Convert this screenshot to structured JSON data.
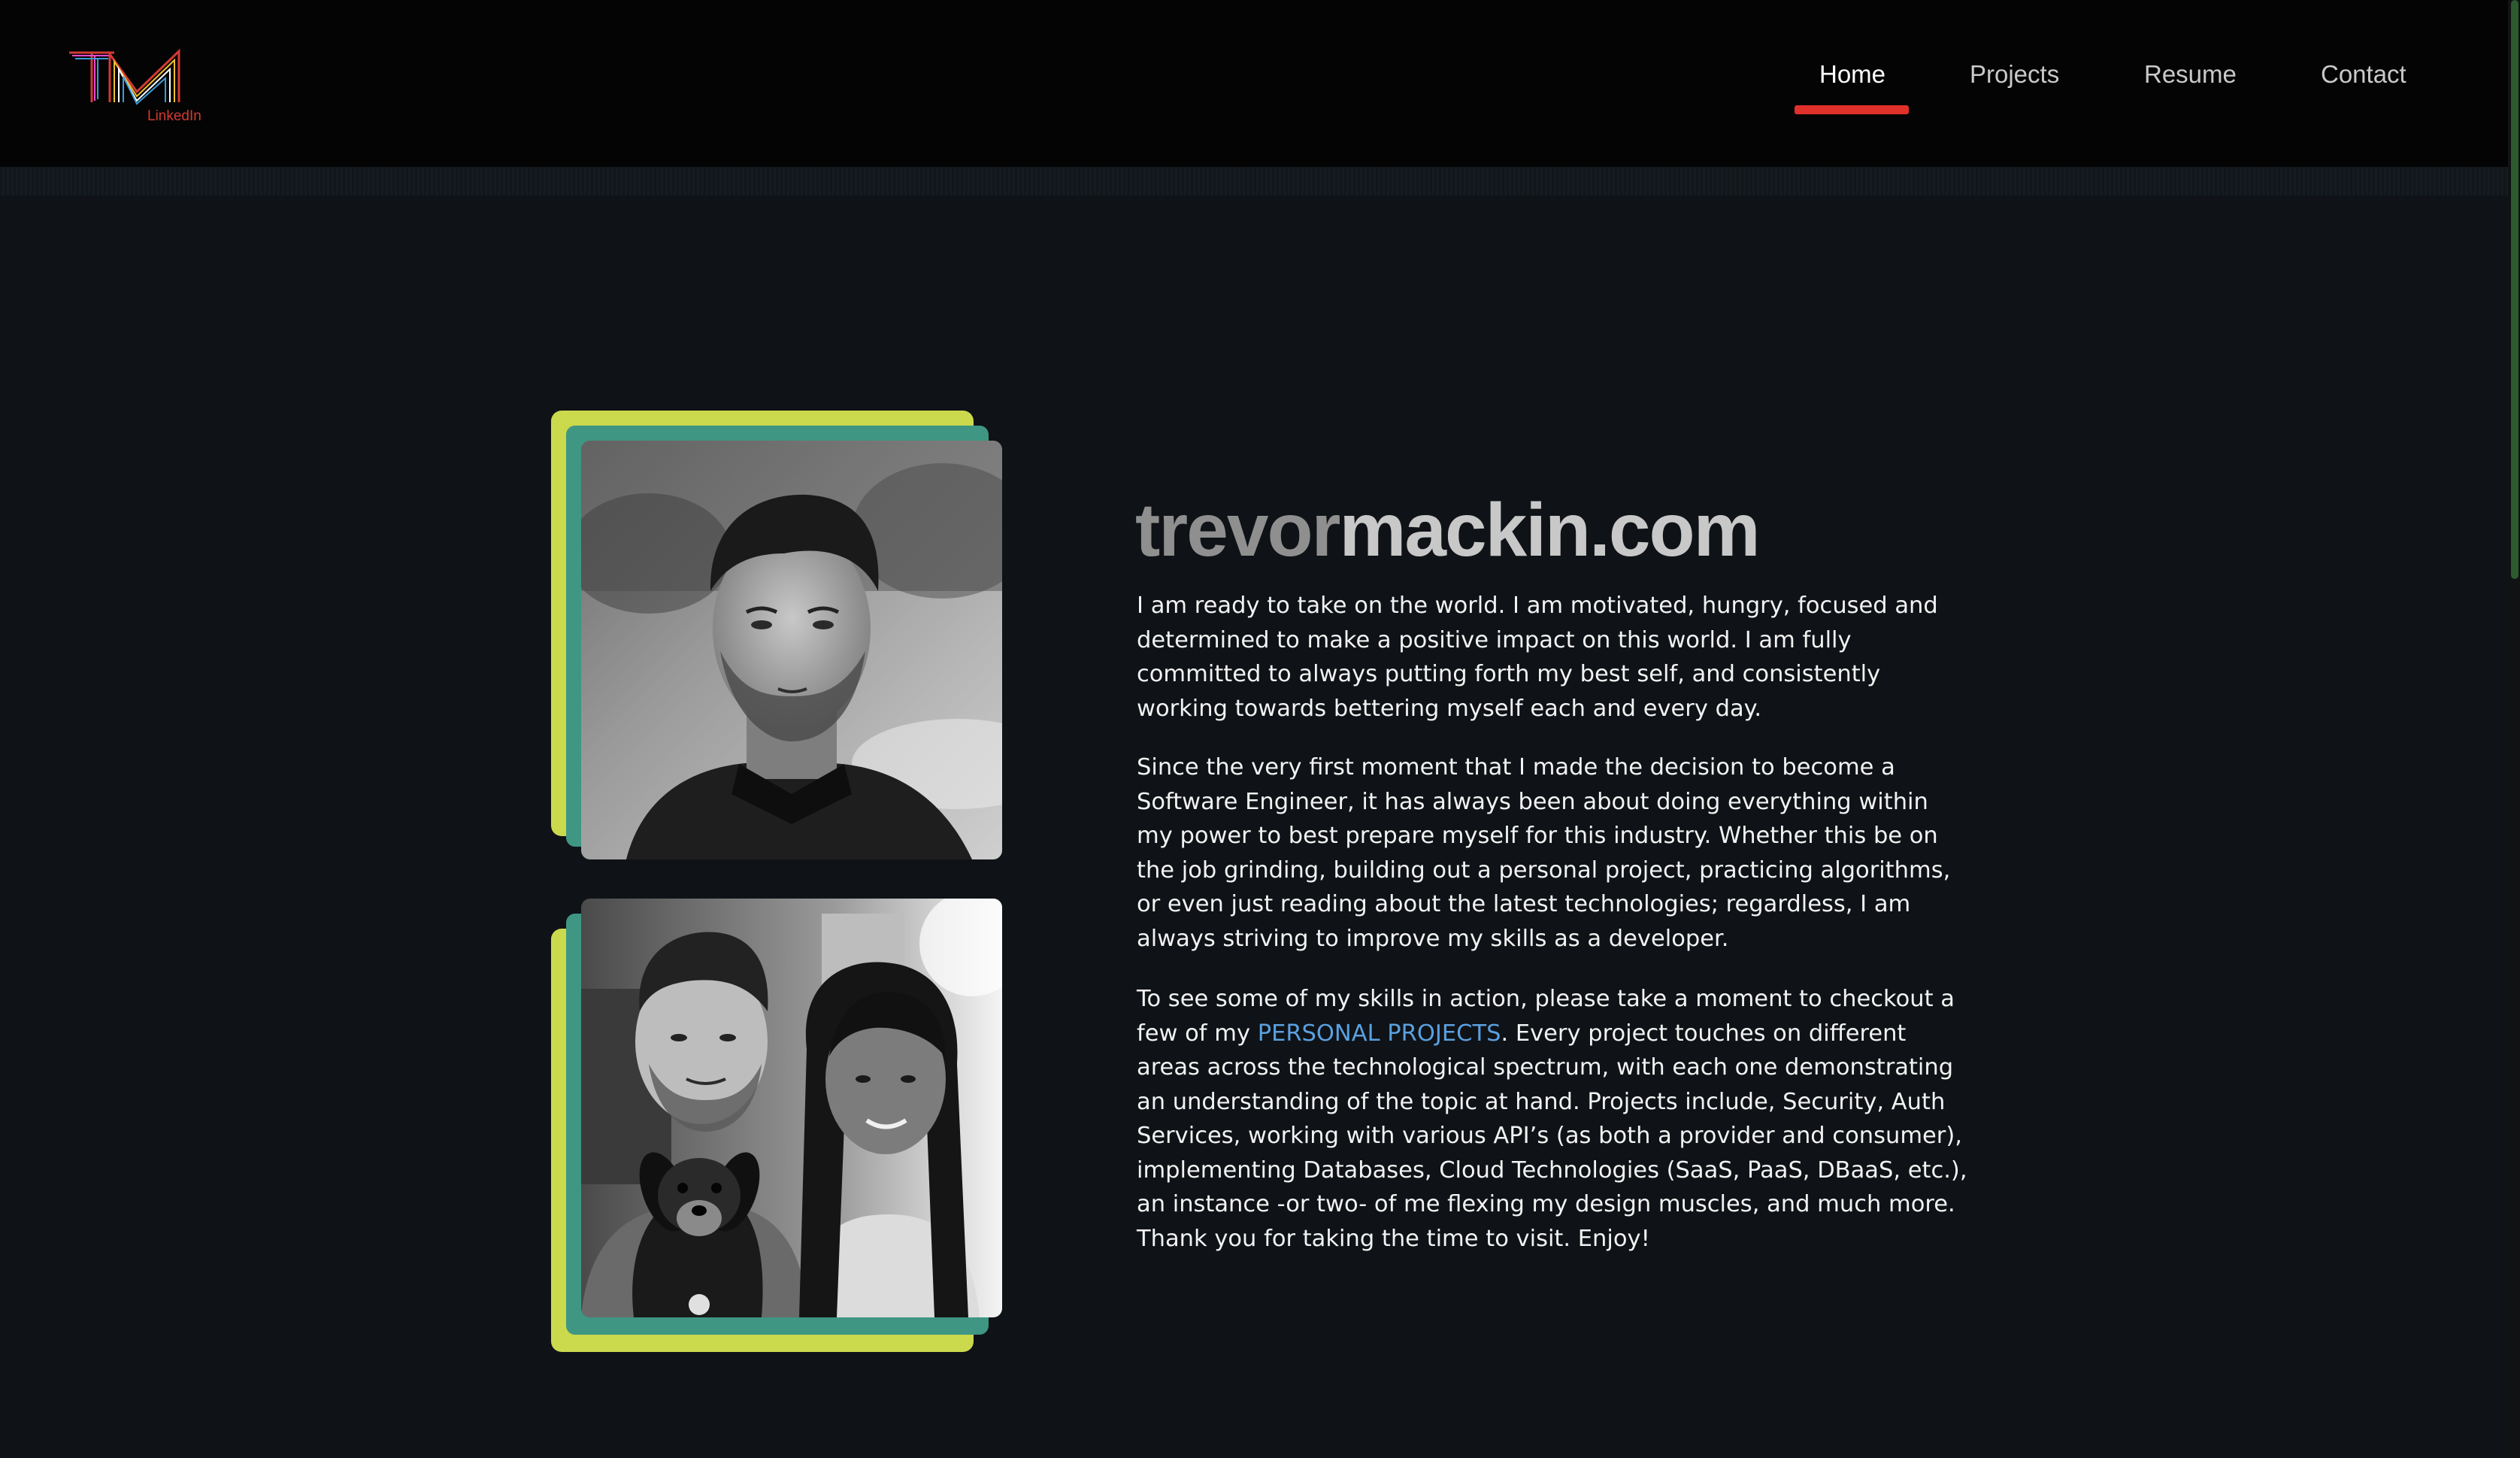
{
  "header": {
    "logo": {
      "monogram": "TM",
      "link_label": "LinkedIn",
      "colors": [
        "#d23a34",
        "#e84bd0",
        "#3a9bd8",
        "#f0c030",
        "#ffffff"
      ]
    },
    "nav": [
      {
        "label": "Home",
        "active": true
      },
      {
        "label": "Projects",
        "active": false
      },
      {
        "label": "Resume",
        "active": false
      },
      {
        "label": "Contact",
        "active": false
      }
    ],
    "active_color": "#e0302a"
  },
  "hero": {
    "title_part_1": "trevor",
    "title_part_2": "mackin.com",
    "paragraph_1": "I am ready to take on the world. I am motivated, hungry, focused and determined to make a positive impact on this world. I am fully committed to always putting forth my best self, and consistently working towards bettering myself each and every day.",
    "paragraph_2": "Since the very first moment that I made the decision to become a Software Engineer, it has always been about doing everything within my power to best prepare myself for this industry. Whether this be on the job grinding, building out a personal project, practicing algorithms, or even just reading about the latest technologies; regardless, I am always striving to improve my skills as a developer.",
    "paragraph_3_before": "To see some of my skills in action, please take a moment to checkout a few of my ",
    "paragraph_3_link": "PERSONAL PROJECTS",
    "paragraph_3_after": ". Every project touches on different areas across the technological spectrum, with each one demonstrating an understanding of the topic at hand. Projects include, Security, Auth Services, working with various API’s (as both a provider and consumer), implementing Databases, Cloud Technologies (SaaS, PaaS, DBaaS, etc.), an instance -or two- of me flexing my design muscles, and much more. Thank you for taking the time to visit. Enjoy!",
    "link_color": "#5aa0e0",
    "frame_colors": {
      "outer": "#cbd94d",
      "inner": "#3f9683"
    }
  }
}
